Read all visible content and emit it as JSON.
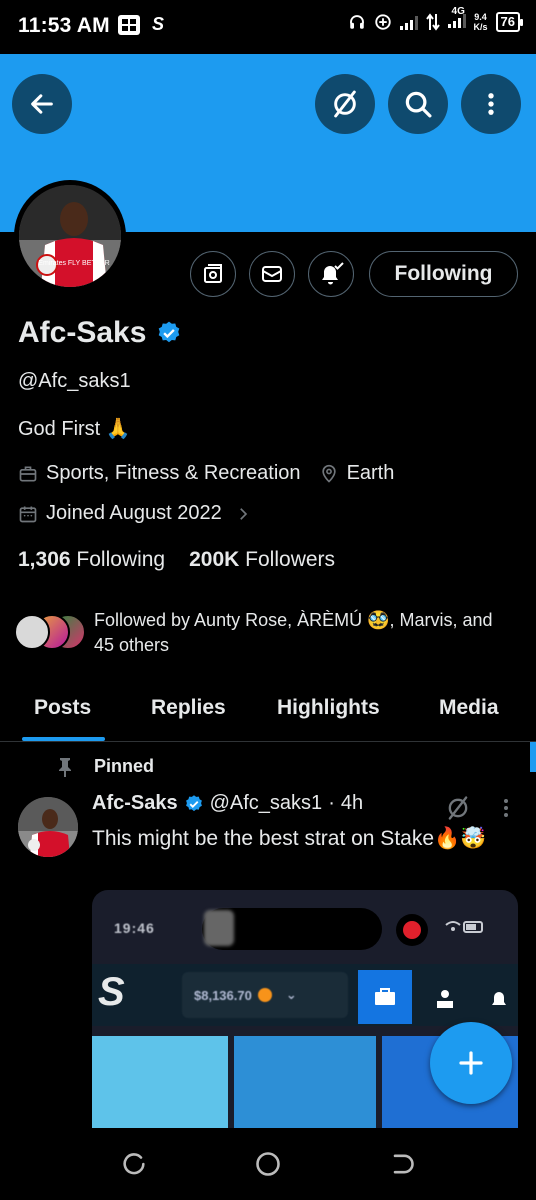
{
  "status_bar": {
    "time": "11:53 AM",
    "app_icon": "S",
    "network": "4G",
    "net_speed_value": "9.4",
    "net_speed_unit": "K/s",
    "battery": "76"
  },
  "profile": {
    "display_name": "Afc-Saks",
    "handle": "@Afc_saks1",
    "bio": "God First 🙏",
    "category": "Sports, Fitness & Recreation",
    "location": "Earth",
    "joined": "Joined August 2022",
    "following_count": "1,306",
    "following_label": "Following",
    "followers_count": "200K",
    "followers_label": "Followers",
    "followed_by": "Followed by Aunty Rose, ÀRÈMÚ 🥸, Marvis, and 45 others",
    "follow_button_label": "Following",
    "jersey_text": "Emirates FLY BETTER"
  },
  "tabs": [
    {
      "label": "Posts"
    },
    {
      "label": "Replies"
    },
    {
      "label": "Highlights"
    },
    {
      "label": "Media"
    }
  ],
  "pinned_tweet": {
    "pinned_label": "Pinned",
    "author_name": "Afc-Saks",
    "author_handle": "@Afc_saks1",
    "separator": "·",
    "time": "4h",
    "text": "This might be the best strat on Stake🔥🤯",
    "media": {
      "phone_time": "19:46",
      "balance": "$8,136.70"
    }
  },
  "icons": {
    "back": "arrow-left-icon",
    "grok": "grok-icon",
    "search": "search-icon",
    "more": "more-vertical-icon",
    "subscribe": "subscribe-icon",
    "message": "envelope-icon",
    "notifications": "bell-check-icon",
    "verified": "verified-badge-icon",
    "category": "briefcase-icon",
    "location": "location-pin-icon",
    "calendar": "calendar-icon",
    "pin": "pin-icon",
    "compose": "plus-icon"
  },
  "colors": {
    "accent": "#1d9bf0",
    "background": "#000000",
    "text": "#e7e9ea",
    "border": "#536471"
  }
}
